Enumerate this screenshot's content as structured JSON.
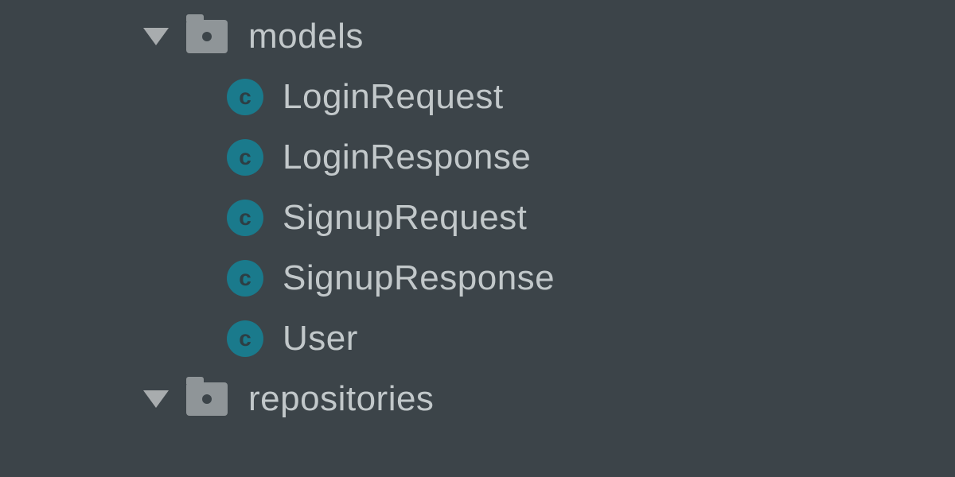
{
  "tree": {
    "folders": [
      {
        "name": "models",
        "expanded": true,
        "children": [
          {
            "name": "LoginRequest",
            "type": "class"
          },
          {
            "name": "LoginResponse",
            "type": "class"
          },
          {
            "name": "SignupRequest",
            "type": "class"
          },
          {
            "name": "SignupResponse",
            "type": "class"
          },
          {
            "name": "User",
            "type": "class"
          }
        ]
      },
      {
        "name": "repositories",
        "expanded": true,
        "children": []
      }
    ]
  },
  "icons": {
    "class_letter": "c"
  }
}
